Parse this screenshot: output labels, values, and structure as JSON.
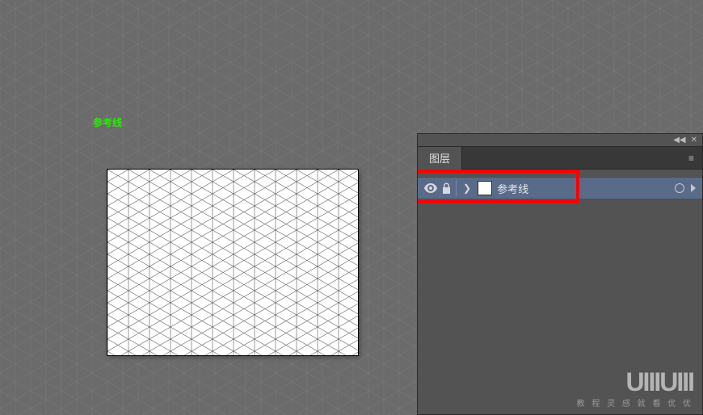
{
  "canvas": {
    "label": "参考线"
  },
  "panel": {
    "title": "图层",
    "collapse_glyph": "◀◀",
    "close_glyph": "✕",
    "menu_glyph": "≡"
  },
  "layers": [
    {
      "name": "参考线",
      "visible": true,
      "locked": true,
      "color": "#5a6b8a",
      "highlighted": true
    }
  ],
  "watermark": {
    "logo": "UIIIUIII",
    "tagline": "教 程 灵 感 就 看 优 优"
  }
}
